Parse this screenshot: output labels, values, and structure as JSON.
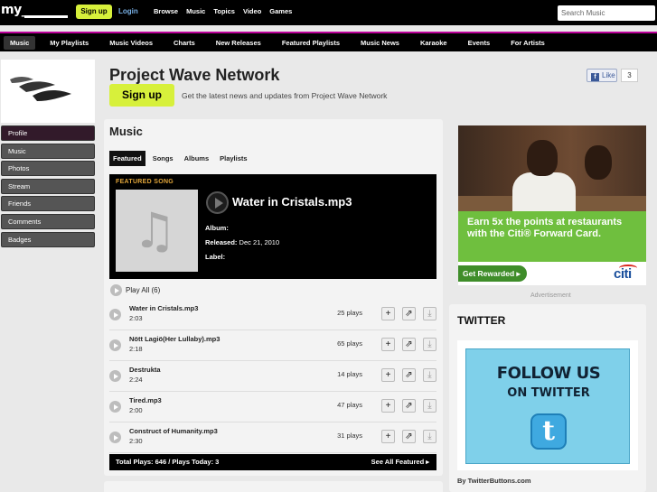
{
  "topbar": {
    "logo": "my_",
    "signup": "Sign up",
    "login": "Login",
    "nav": [
      "Browse",
      "Music",
      "Topics",
      "Video",
      "Games"
    ],
    "search_placeholder": "Search Music"
  },
  "subnav": {
    "items": [
      "Music",
      "My Playlists",
      "Music Videos",
      "Charts",
      "New Releases",
      "Featured Playlists",
      "Music News",
      "Karaoke",
      "Events",
      "For Artists"
    ],
    "active": "Music"
  },
  "sidebar": {
    "items": [
      "Profile",
      "Music",
      "Photos",
      "Stream",
      "Friends",
      "Comments",
      "Badges"
    ],
    "active": "Profile"
  },
  "header": {
    "title": "Project Wave Network",
    "signup": "Sign up",
    "tagline": "Get the latest news and updates from Project Wave Network",
    "like_label": "Like",
    "like_count": "3"
  },
  "music": {
    "title": "Music",
    "tabs": [
      "Featured",
      "Songs",
      "Albums",
      "Playlists"
    ],
    "active_tab": "Featured",
    "featured": {
      "label": "FEATURED SONG",
      "title": "Water in Cristals.mp3",
      "album_label": "Album:",
      "album_value": "",
      "released_label": "Released:",
      "released_value": "Dec 21, 2010",
      "label_label": "Label:",
      "label_value": ""
    },
    "play_all": "Play All (6)",
    "songs": [
      {
        "name": "Water in Cristals.mp3",
        "duration": "2:03",
        "plays": "25 plays"
      },
      {
        "name": "Nött Lagiö(Her Lullaby).mp3",
        "duration": "2:18",
        "plays": "65 plays"
      },
      {
        "name": "Destrukta",
        "duration": "2:24",
        "plays": "14 plays"
      },
      {
        "name": "Tired.mp3",
        "duration": "2:00",
        "plays": "47 plays"
      },
      {
        "name": "Construct of Humanity.mp3",
        "duration": "2:30",
        "plays": "31 plays"
      }
    ],
    "totals": "Total Plays: 646 / Plays Today: 3",
    "see_all": "See All Featured ▸"
  },
  "ad": {
    "headline": "Earn 5x the points at restaurants with the Citi® Forward Card.",
    "cta": "Get Rewarded ▸",
    "brand": "citi",
    "label": "Advertisement"
  },
  "twitter": {
    "title": "TWITTER",
    "line1": "FOLLOW US",
    "line2": "ON TWITTER",
    "logo_letter": "t",
    "by": "By TwitterButtons.com"
  },
  "colors": {
    "accent_green": "#d7f03b",
    "brand_magenta": "#bb0099",
    "ad_green": "#6fbf3e",
    "featured_orange": "#e0a53a"
  }
}
